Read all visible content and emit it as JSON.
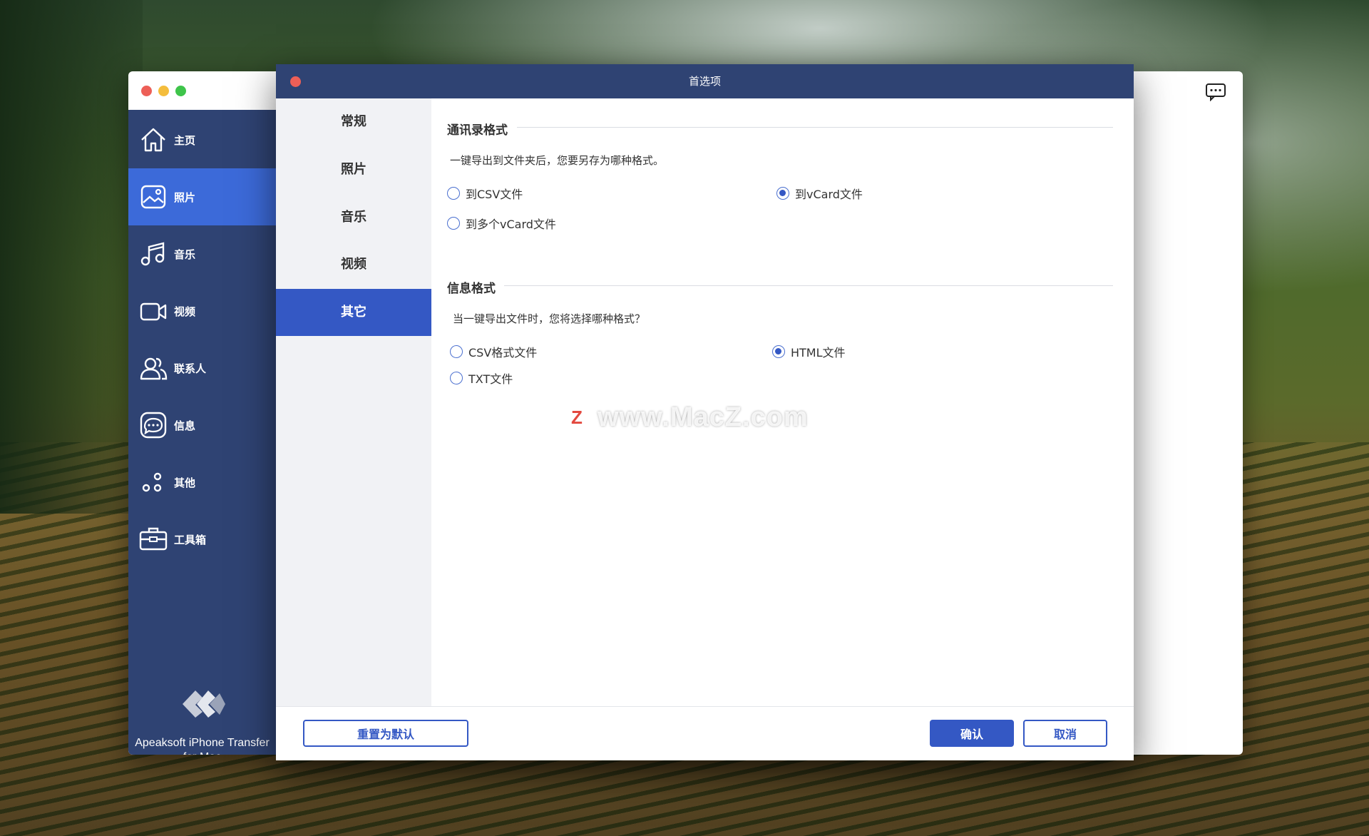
{
  "app": {
    "brand_name": "Apeaksoft iPhone Transfer for Mac",
    "nav": [
      {
        "label": "主页",
        "icon": "home-icon"
      },
      {
        "label": "照片",
        "icon": "photo-icon"
      },
      {
        "label": "音乐",
        "icon": "music-icon"
      },
      {
        "label": "视频",
        "icon": "video-icon"
      },
      {
        "label": "联系人",
        "icon": "contacts-icon"
      },
      {
        "label": "信息",
        "icon": "messages-icon"
      },
      {
        "label": "其他",
        "icon": "other-icon"
      },
      {
        "label": "工具箱",
        "icon": "toolbox-icon"
      }
    ],
    "active_nav": "照片"
  },
  "dialog": {
    "title": "首选项",
    "tabs": [
      "常规",
      "照片",
      "音乐",
      "视频",
      "其它"
    ],
    "active_tab": "其它",
    "contacts_section": {
      "title": "通讯录格式",
      "description": "一键导出到文件夹后，您要另存为哪种格式。",
      "options": [
        {
          "label": "到CSV文件",
          "checked": false
        },
        {
          "label": "到vCard文件",
          "checked": true
        },
        {
          "label": "到多个vCard文件",
          "checked": false
        }
      ]
    },
    "messages_section": {
      "title": "信息格式",
      "description": "当一键导出文件时，您将选择哪种格式？",
      "options": [
        {
          "label": "CSV格式文件",
          "checked": false
        },
        {
          "label": "HTML文件",
          "checked": true
        },
        {
          "label": "TXT文件",
          "checked": false
        }
      ]
    },
    "buttons": {
      "reset": "重置为默认",
      "confirm": "确认",
      "cancel": "取消"
    }
  },
  "watermark": {
    "logo_letter": "Z",
    "text": "www.MacZ.com"
  },
  "colors": {
    "sidebar": "#2f4373",
    "accent": "#3458c4",
    "active_nav": "#3c6ad9"
  }
}
